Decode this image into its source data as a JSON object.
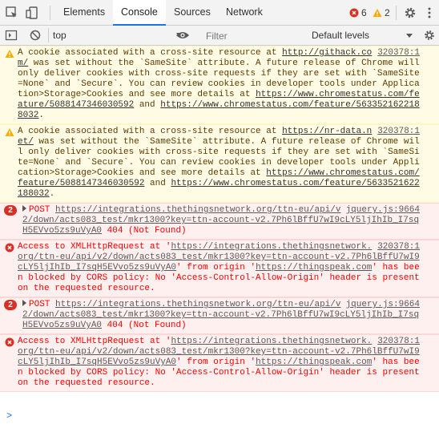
{
  "tabs": {
    "items": [
      "Elements",
      "Console",
      "Sources",
      "Network"
    ],
    "active": "Console"
  },
  "counters": {
    "errors": "6",
    "warnings": "2"
  },
  "toolbar": {
    "context": "top",
    "filter_placeholder": "Filter",
    "levels": "Default levels"
  },
  "messages": [
    {
      "type": "warning",
      "source": "320378:1",
      "text_parts": [
        "A cookie associated with a cross-site resource at ",
        {
          "link": "http://githack.com/"
        },
        " was set without the `SameSite` attribute. A future release of Chrome will only deliver cookies with cross-site requests if they are set with `SameSite=None` and `Secure`. You can review cookies in developer tools under Application>Storage>Cookies and see more details at ",
        {
          "link": "https://www.chromestatus.com/feature/5088147346030592"
        },
        " and ",
        {
          "link": "https://www.chromestatus.com/feature/5633521622188032"
        },
        "."
      ]
    },
    {
      "type": "warning",
      "source": "320378:1",
      "text_parts": [
        "A cookie associated with a cross-site resource at ",
        {
          "link": "https://nr-data.net/"
        },
        " was set without the `SameSite` attribute. A future release of Chrome will only deliver cookies with cross-site requests if they are set with `SameSite=None` and `Secure`. You can review cookies in developer tools under Application>Storage>Cookies and see more details at ",
        {
          "link": "https://www.chromestatus.com/feature/5088147346030592"
        },
        " and ",
        {
          "link": "https://www.chromestatus.com/feature/5633521622188032"
        },
        "."
      ]
    },
    {
      "type": "error",
      "repeat": "2",
      "expandable": true,
      "source": "jquery.js:9664",
      "text_parts": [
        "POST ",
        {
          "link": "https://integrations.thethingsnetwork.org/ttn-eu/api/v2/down/acts083_test/mkr1300?key=ttn-account-v2.7Ph6lBffU7wI9cLY5ljIhIb_I7sqH5EVvo5zs9uVyA0"
        },
        " 404 (Not Found)"
      ]
    },
    {
      "type": "error",
      "source": "320378:1",
      "text_parts": [
        "Access to XMLHttpRequest at '",
        {
          "link": "https://integrations.thethingsnetwork.org/ttn-eu/api/v2/down/acts083_test/mkr1300?key=ttn-account-v2.7Ph6lBffU7wI9cLY5ljIhIb_I7sqH5EVvo5zs9uVyA0"
        },
        "' from origin '",
        {
          "link": "https://thingspeak.com"
        },
        "' has been blocked by CORS policy: No 'Access-Control-Allow-Origin' header is present on the requested resource."
      ]
    },
    {
      "type": "error",
      "repeat": "2",
      "expandable": true,
      "source": "jquery.js:9664",
      "text_parts": [
        "POST ",
        {
          "link": "https://integrations.thethingsnetwork.org/ttn-eu/api/v2/down/acts083_test/mkr1300?key=ttn-account-v2.7Ph6lBffU7wI9cLY5ljIhIb_I7sqH5EVvo5zs9uVyA0"
        },
        " 404 (Not Found)"
      ]
    },
    {
      "type": "error",
      "source": "320378:1",
      "text_parts": [
        "Access to XMLHttpRequest at '",
        {
          "link": "https://integrations.thethingsnetwork.org/ttn-eu/api/v2/down/acts083_test/mkr1300?key=ttn-account-v2.7Ph6lBffU7wI9cLY5ljIhIb_I7sqH5EVvo5zs9uVyA0"
        },
        "' from origin '",
        {
          "link": "https://thingspeak.com"
        },
        "' has been blocked by CORS policy: No 'Access-Control-Allow-Origin' header is present on the requested resource."
      ]
    }
  ],
  "prompt": ">",
  "colors": {
    "warning_bg": "#fffbe5",
    "error_bg": "#fff0f0",
    "error_text": "#ff0000",
    "accent": "#1a73e8"
  }
}
